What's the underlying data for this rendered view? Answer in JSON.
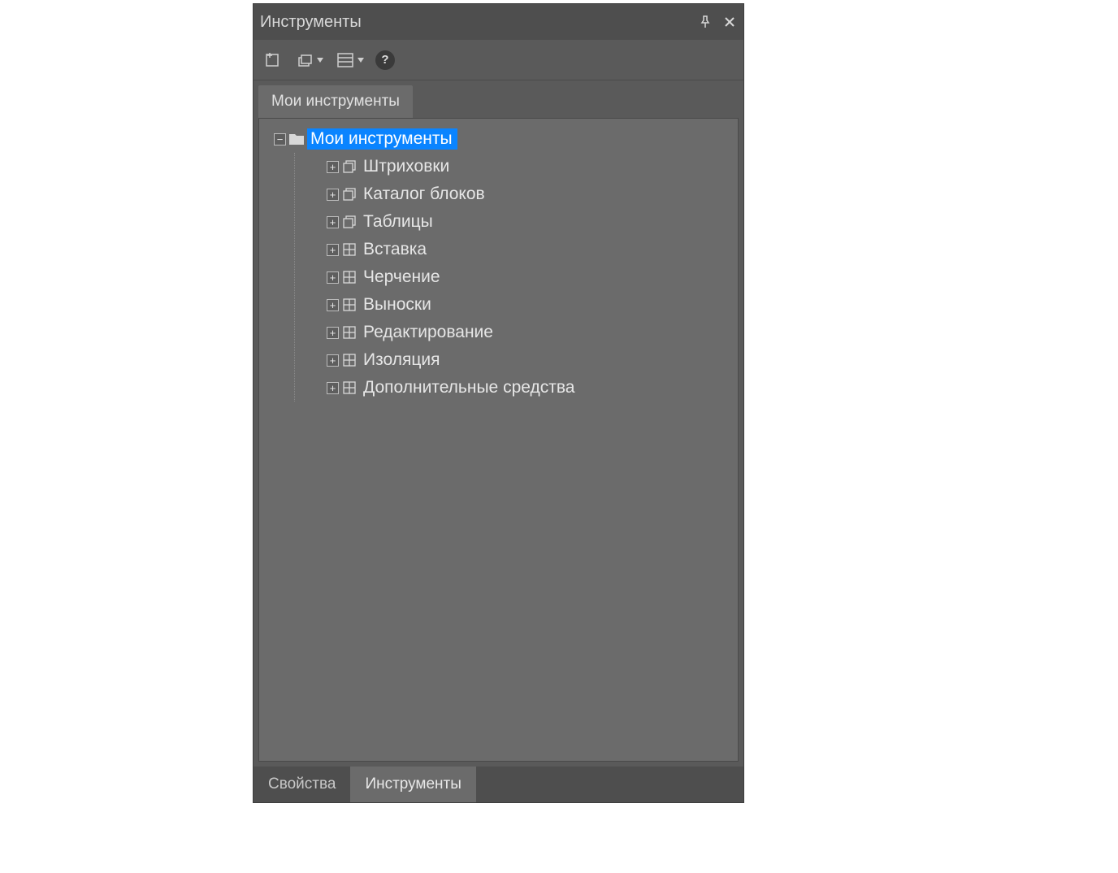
{
  "panel": {
    "title": "Инструменты"
  },
  "toolbar": {
    "help_glyph": "?"
  },
  "topTab": {
    "label": "Мои инструменты"
  },
  "tree": {
    "root": {
      "label": "Мои инструменты",
      "selected": true,
      "children": [
        {
          "label": "Штриховки",
          "icon": "stack"
        },
        {
          "label": "Каталог блоков",
          "icon": "stack"
        },
        {
          "label": "Таблицы",
          "icon": "stack"
        },
        {
          "label": "Вставка",
          "icon": "grid"
        },
        {
          "label": "Черчение",
          "icon": "grid"
        },
        {
          "label": "Выноски",
          "icon": "grid"
        },
        {
          "label": "Редактирование",
          "icon": "grid"
        },
        {
          "label": "Изоляция",
          "icon": "grid"
        },
        {
          "label": "Дополнительные средства",
          "icon": "grid"
        }
      ]
    }
  },
  "bottomTabs": {
    "items": [
      {
        "label": "Свойства",
        "active": false
      },
      {
        "label": "Инструменты",
        "active": true
      }
    ]
  }
}
